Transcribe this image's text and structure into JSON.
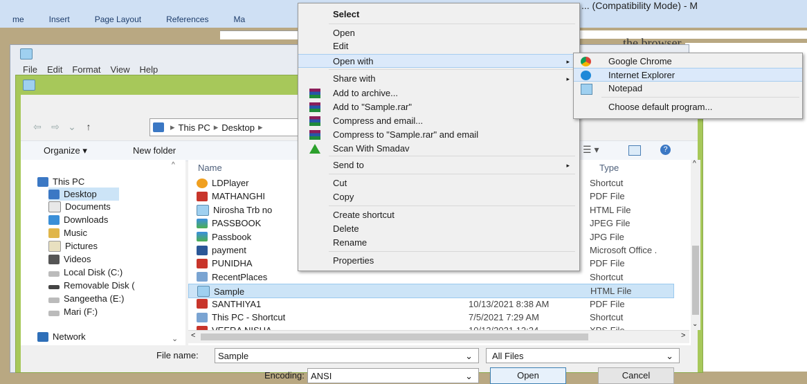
{
  "word": {
    "tabs": [
      "me",
      "Insert",
      "Page Layout",
      "References",
      "Ma"
    ],
    "title_fragment": "... (Compatibility Mode) - M",
    "doc_heading": "the browser"
  },
  "notepad": {
    "menu": [
      "File",
      "Edit",
      "Format",
      "View",
      "Help"
    ]
  },
  "dialog": {
    "breadcrumb": [
      "This PC",
      "Desktop"
    ],
    "toolbar": {
      "organize": "Organize ▾",
      "new_folder": "New folder"
    },
    "columns": {
      "name": "Name",
      "type": "Type"
    },
    "nav": [
      {
        "label": "This PC",
        "icon": "computer-icon"
      },
      {
        "label": "Desktop",
        "icon": "desktop-folder-icon"
      },
      {
        "label": "Documents",
        "icon": "documents-icon"
      },
      {
        "label": "Downloads",
        "icon": "downloads-icon"
      },
      {
        "label": "Music",
        "icon": "music-icon"
      },
      {
        "label": "Pictures",
        "icon": "pictures-icon"
      },
      {
        "label": "Videos",
        "icon": "videos-icon"
      },
      {
        "label": "Local Disk (C:)",
        "icon": "drive-icon"
      },
      {
        "label": "Removable Disk (",
        "icon": "removable-drive-icon"
      },
      {
        "label": "Sangeetha (E:)",
        "icon": "drive-icon"
      },
      {
        "label": "Mari (F:)",
        "icon": "drive-icon"
      },
      {
        "label": "Network",
        "icon": "network-icon"
      }
    ],
    "files": [
      {
        "name": "LDPlayer",
        "date": "",
        "type": "Shortcut",
        "icon": "app-shortcut-icon"
      },
      {
        "name": "MATHANGHI",
        "date": "",
        "type": "PDF File",
        "icon": "pdf-icon"
      },
      {
        "name": "Nirosha Trb no",
        "date": "",
        "type": "HTML File",
        "icon": "html-file-icon"
      },
      {
        "name": "PASSBOOK",
        "date": "",
        "type": "JPEG File",
        "icon": "image-icon"
      },
      {
        "name": "Passbook",
        "date": "",
        "type": "JPG File",
        "icon": "image-icon"
      },
      {
        "name": "payment",
        "date": "",
        "type": "Microsoft Office .",
        "icon": "word-doc-icon"
      },
      {
        "name": "PUNIDHA",
        "date": "",
        "type": "PDF File",
        "icon": "pdf-icon"
      },
      {
        "name": "RecentPlaces",
        "date": "",
        "type": "Shortcut",
        "icon": "shortcut-icon"
      },
      {
        "name": "Sample",
        "date": "",
        "type": "HTML File",
        "icon": "html-file-icon"
      },
      {
        "name": "SANTHIYA1",
        "date": "10/13/2021 8:38 AM",
        "type": "PDF File",
        "icon": "pdf-icon"
      },
      {
        "name": "This PC - Shortcut",
        "date": "7/5/2021 7:29 AM",
        "type": "Shortcut",
        "icon": "shortcut-icon"
      },
      {
        "name": "VEERA NISHA",
        "date": "10/12/2021 12:24 ...",
        "type": "XPS File",
        "icon": "pdf-icon"
      }
    ],
    "selected_index": 8,
    "footer": {
      "file_name_label": "File name:",
      "file_name_value": "Sample",
      "filter_value": "All Files",
      "encoding_label": "Encoding:",
      "encoding_value": "ANSI",
      "open_label": "Open",
      "cancel_label": "Cancel"
    }
  },
  "context_menu": {
    "items": [
      {
        "label": "Select",
        "bold": true
      },
      {
        "label": "Open"
      },
      {
        "label": "Edit"
      },
      {
        "label": "Open with",
        "submenu": true,
        "highlighted": true
      },
      {
        "label": "Share with",
        "submenu": true
      },
      {
        "label": "Add to archive...",
        "icon": "winrar-icon"
      },
      {
        "label": "Add to \"Sample.rar\"",
        "icon": "winrar-icon"
      },
      {
        "label": "Compress and email...",
        "icon": "winrar-icon"
      },
      {
        "label": "Compress to \"Sample.rar\" and email",
        "icon": "winrar-icon"
      },
      {
        "label": "Scan With Smadav",
        "icon": "smadav-icon"
      },
      {
        "label": "Send to",
        "submenu": true
      },
      {
        "label": "Cut"
      },
      {
        "label": "Copy"
      },
      {
        "label": "Create shortcut"
      },
      {
        "label": "Delete"
      },
      {
        "label": "Rename"
      },
      {
        "label": "Properties"
      }
    ]
  },
  "open_with": {
    "items": [
      {
        "label": "Google Chrome",
        "icon": "chrome-icon"
      },
      {
        "label": "Internet Explorer",
        "icon": "ie-icon",
        "highlighted": true
      },
      {
        "label": "Notepad",
        "icon": "notepad-icon"
      },
      {
        "label": "Choose default program..."
      }
    ]
  },
  "colors": {
    "dialog_frame": "#a7c85a",
    "highlight": "#cce4f7",
    "pdf_red": "#c8352b"
  }
}
